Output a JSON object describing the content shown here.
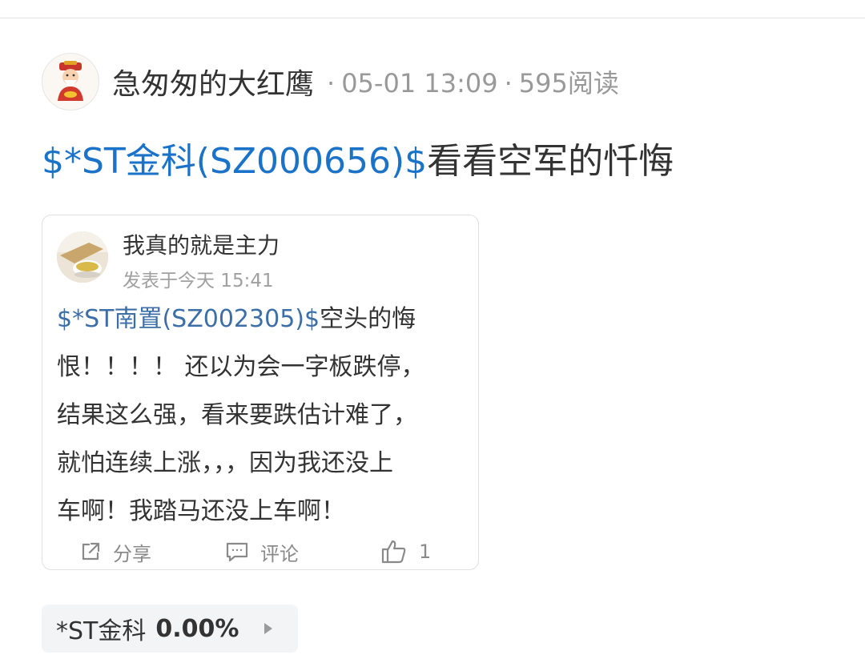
{
  "post": {
    "author_name": "急匆匆的大红鹰",
    "date": "05-01 13:09",
    "views": "595阅读",
    "separator": "·",
    "title_stock": "$*ST金科(SZ000656)$",
    "title_text": "看看空军的忏悔"
  },
  "quoted": {
    "username": "我真的就是主力",
    "posted_time": "发表于今天 15:41",
    "stock": "$*ST南置(SZ002305)$",
    "line1_rest": "空头的悔",
    "line2": "恨！！！！ 还以为会一字板跌停，",
    "line3": "结果这么强，看来要跌估计难了，",
    "line4": "就怕连续上涨，，，因为我还没上",
    "line5": "车啊！我踏马还没上车啊！",
    "actions": {
      "share_label": "分享",
      "comment_label": "评论",
      "like_count": "1"
    }
  },
  "stock_chip": {
    "name": "*ST金科",
    "change": "0.00%"
  },
  "colors": {
    "link_blue": "#1a73c8",
    "quote_link_blue": "#3c6ea8",
    "meta_gray": "#999999"
  },
  "icons": {
    "author_avatar": "fortune-god-avatar",
    "quote_avatar": "tea-cup-avatar",
    "share": "share-icon",
    "comment": "comment-icon",
    "like": "thumbs-up-icon",
    "chip_arrow": "play-arrow-icon"
  }
}
